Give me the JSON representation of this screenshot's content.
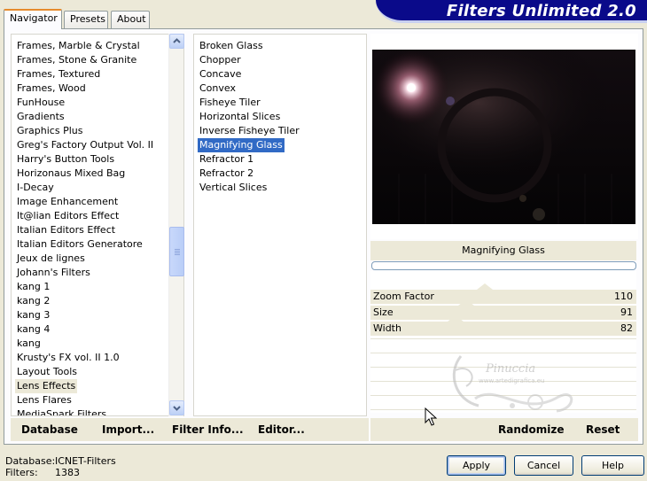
{
  "tabs": [
    "Navigator",
    "Presets",
    "About"
  ],
  "banner_title": "Filters Unlimited 2.0",
  "categories": [
    "Frames, Marble & Crystal",
    "Frames, Stone & Granite",
    "Frames, Textured",
    "Frames, Wood",
    "FunHouse",
    "Gradients",
    "Graphics Plus",
    "Greg's Factory Output Vol. II",
    "Harry's Button Tools",
    "Horizonaus Mixed Bag",
    "I-Decay",
    "Image Enhancement",
    "It@lian Editors Effect",
    "Italian Editors Effect",
    "Italian Editors Generatore",
    "Jeux de lignes",
    "Johann's Filters",
    "kang 1",
    "kang 2",
    "kang 3",
    "kang 4",
    "kang",
    "Krusty's FX vol. II 1.0",
    "Layout Tools",
    "Lens Effects",
    "Lens Flares",
    "MediaSpark Filters"
  ],
  "selected_category_index": 24,
  "filters": [
    "Broken Glass",
    "Chopper",
    "Concave",
    "Convex",
    "Fisheye Tiler",
    "Horizontal Slices",
    "Inverse Fisheye Tiler",
    "Magnifying Glass",
    "Refractor 1",
    "Refractor 2",
    "Vertical Slices"
  ],
  "selected_filter_index": 7,
  "preview_filter_name": "Magnifying Glass",
  "params": [
    {
      "label": "Zoom Factor",
      "value": "110",
      "level": 0.43
    },
    {
      "label": "Size",
      "value": "91",
      "level": 0.36
    },
    {
      "label": "Width",
      "value": "82",
      "level": 0.32
    }
  ],
  "toolbar": {
    "database": "Database",
    "import": "Import...",
    "filter_info": "Filter Info...",
    "editor": "Editor...",
    "randomize": "Randomize",
    "reset": "Reset"
  },
  "status": {
    "database_label": "Database:",
    "database_value": "ICNET-Filters",
    "filters_label": "Filters:",
    "filters_value": "1383"
  },
  "buttons": {
    "apply": "Apply",
    "cancel": "Cancel",
    "help": "Help"
  },
  "watermark_text": "Pinuccia",
  "watermark_url": "www.artedigrafica.eu",
  "colors": {
    "selection_blue": "#316ac5",
    "banner_blue": "#0a0a8a",
    "panel_bg": "#ece9d8"
  }
}
